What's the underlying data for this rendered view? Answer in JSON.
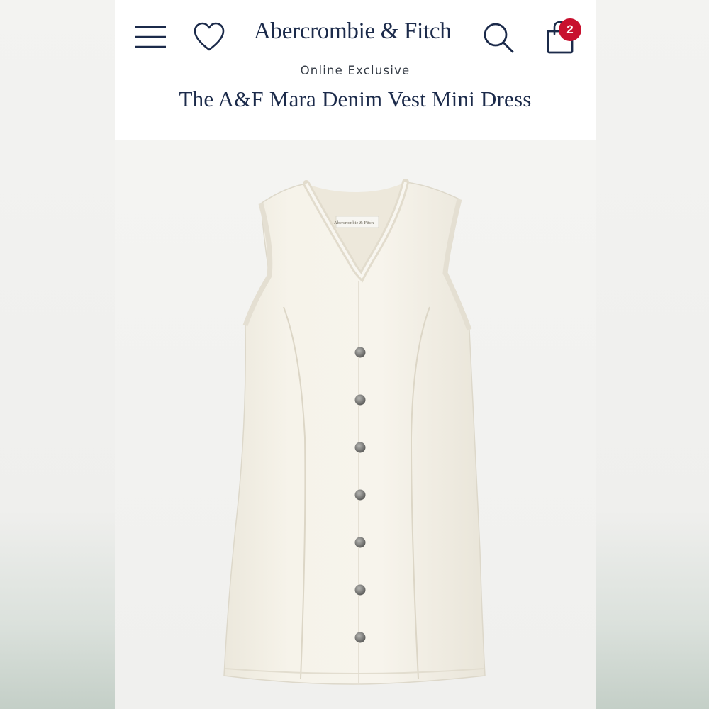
{
  "header": {
    "brand": "Abercrombie & Fitch",
    "bag_count": "2",
    "icons": [
      "menu-icon",
      "heart-icon",
      "search-icon",
      "shopping-bag-icon"
    ]
  },
  "product": {
    "eyebrow": "Online Exclusive",
    "title": "The A&F Mara Denim Vest Mini Dress",
    "label_text": "Abercrombie & Fitch",
    "button_count": 7
  },
  "colors": {
    "brand_navy": "#1b2a4a",
    "badge_red": "#c8102e",
    "dress_cream": "#f4f1e8"
  }
}
